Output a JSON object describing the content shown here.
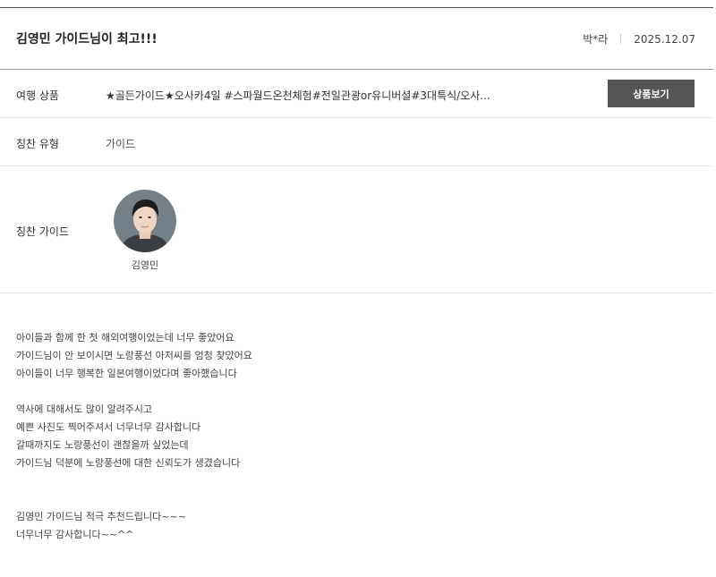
{
  "review": {
    "title": "김영민 가이드님이 최고!!!",
    "author": "박*라",
    "date": "2025.12.07"
  },
  "product": {
    "label": "여행 상품",
    "value": "★골든가이드★오사카4일 #스파월드온천체험#전일관광or유니버셜#3대특식/오사...",
    "button_label": "상품보기"
  },
  "praise_type": {
    "label": "칭찬 유형",
    "value": "가이드"
  },
  "praise_guide": {
    "label": "칭찬 가이드",
    "name": "김영민"
  },
  "body": {
    "lines": [
      "아이들과 함께 한 첫 해외여행이었는데 너무 좋았어요",
      "가이드님이 안 보이시면 노랑풍선 아저씨를 엄청 찾았어요",
      "아이들이 너무 행복한 일본여행이었다며 좋아했습니다",
      "",
      "역사에 대해서도 많이 알려주시고",
      "예쁜 사진도 찍어주셔서 너무너무 감사합니다",
      "갈때까지도 노랑풍선이 괜찮을까 싶었는데",
      "가이드님 덕분에 노랑풍선에 대한 신뢰도가 생겼습니다",
      "",
      "",
      "김영민 가이드님 적극 추천드립니다~~~",
      "너무너무 감사합니다~~^^"
    ]
  },
  "icons": {
    "avatar": "guide-profile-photo"
  },
  "colors": {
    "button_bg": "#555555",
    "header_rule": "#555555",
    "row_rule": "#e3e3e3"
  }
}
